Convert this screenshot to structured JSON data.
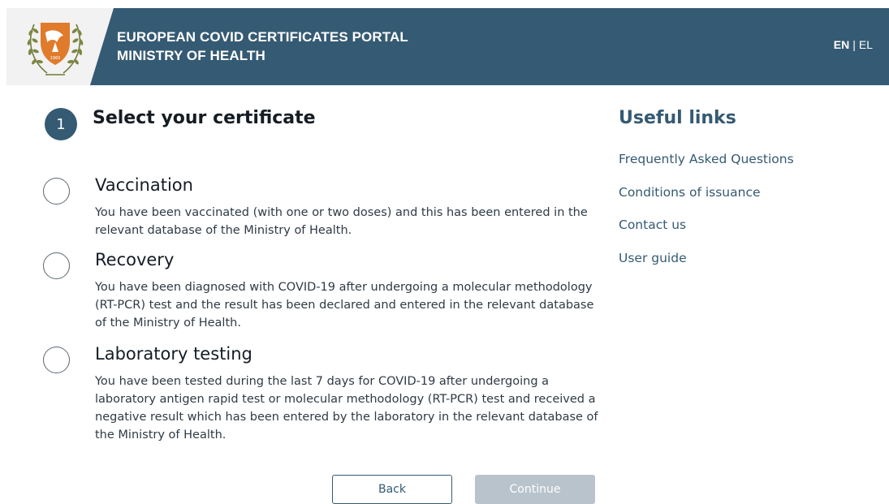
{
  "header": {
    "title_line1": "EUROPEAN COVID CERTIFICATES PORTAL",
    "title_line2": "MINISTRY OF HEALTH",
    "lang_en": "EN",
    "lang_sep": "|",
    "lang_el": "EL",
    "logo_icon": "cyprus-coat-of-arms-icon"
  },
  "step": {
    "number": "1",
    "title": "Select your certificate"
  },
  "options": [
    {
      "title": "Vaccination",
      "description": "You have been vaccinated (with one or two doses) and this has been entered in the relevant database of the Ministry of Health."
    },
    {
      "title": "Recovery",
      "description": "You have been diagnosed with COVID-19 after undergoing a molecular methodology (RT-PCR) test and the result has been declared and entered in the relevant database of the Ministry of Health."
    },
    {
      "title": "Laboratory testing",
      "description": "You have been tested during the last 7 days for COVID-19 after undergoing a laboratory antigen rapid test or molecular methodology (RT-PCR) test and received a negative result which has been entered by the laboratory in the relevant database of the Ministry of Health."
    }
  ],
  "buttons": {
    "back": "Back",
    "continue": "Continue"
  },
  "useful_links": {
    "title": "Useful links",
    "items": [
      "Frequently Asked Questions",
      "Conditions of issuance",
      "Contact us",
      "User guide"
    ]
  },
  "colors": {
    "primary": "#355a73",
    "disabled_button": "#b9c3cc",
    "logo_orange": "#e07b2c",
    "logo_olive": "#6f7a3a"
  }
}
